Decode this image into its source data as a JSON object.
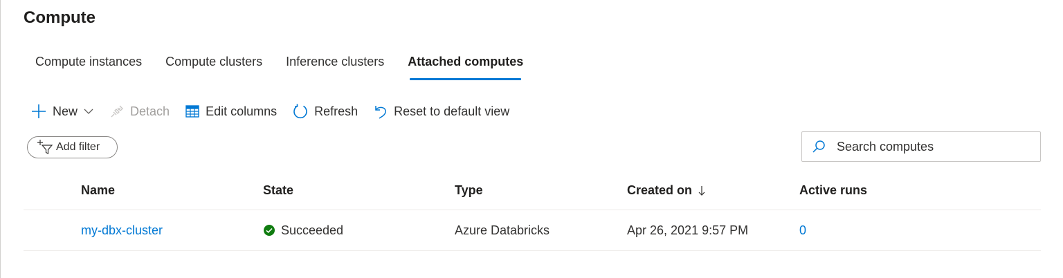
{
  "page": {
    "title": "Compute"
  },
  "tabs": [
    {
      "label": "Compute instances"
    },
    {
      "label": "Compute clusters"
    },
    {
      "label": "Inference clusters"
    },
    {
      "label": "Attached computes",
      "active": true
    }
  ],
  "toolbar": {
    "new_label": "New",
    "detach_label": "Detach",
    "edit_columns_label": "Edit columns",
    "refresh_label": "Refresh",
    "reset_label": "Reset to default view"
  },
  "filter": {
    "add_filter_label": "Add filter"
  },
  "search": {
    "placeholder": "Search computes"
  },
  "table": {
    "columns": [
      "Name",
      "State",
      "Type",
      "Created on",
      "Active runs"
    ],
    "sort": {
      "column": "Created on",
      "direction": "descending"
    },
    "rows": [
      {
        "name": "my-dbx-cluster",
        "state": "Succeeded",
        "type": "Azure Databricks",
        "created_on": "Apr 26, 2021 9:57 PM",
        "active_runs": "0"
      }
    ]
  },
  "colors": {
    "accent": "#0078d4",
    "success": "#107c10",
    "disabled": "#a19f9d"
  }
}
